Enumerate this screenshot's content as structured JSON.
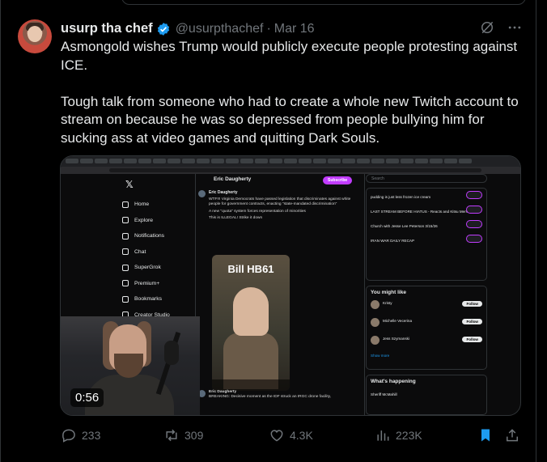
{
  "post": {
    "author_name": "usurp tha chef",
    "handle": "@usurpthachef",
    "separator": "·",
    "date": "Mar 16",
    "paragraphs": [
      "Asmongold wishes Trump would publicly execute people protesting against ICE.",
      "Tough talk from someone who had to create a whole new Twitch account to stream on because he was so depressed from people bullying him for sucking ass at video games and quitting Dark Souls."
    ]
  },
  "media": {
    "duration": "0:56",
    "screen": {
      "nav": [
        "Home",
        "Explore",
        "Notifications",
        "Chat",
        "SuperGrok",
        "Premium+",
        "Bookmarks",
        "Creator Studio"
      ],
      "profile_name": "Eric Daugherty",
      "subscribe_label": "Subscribe",
      "post_text": "WTF!!! Virginia Democrats have passed legislation that discriminates against white people for government contracts, enacting \"state-mandated discrimination\"",
      "post_text_2": "A new \"quota\" system forces representation of minorities",
      "post_text_3": "This is ILLEGAL! Strike it down",
      "video_caption": "Bill HB61",
      "post2_text": "BREAKING: Decisive moment as the IDF struck an IRGC drone facility,",
      "search_placeholder": "Search",
      "trends": [
        "pudding is just less frozen ice cream",
        "LAST STREAM BEFORE HIATUS - Reacts and Kitsu Meme ...",
        "Church with Jesse Lee Peterson 3/15/26",
        "IRAN WAR DAILY RECAP"
      ],
      "you_might_like": "You might like",
      "users": [
        "Kristy",
        "Michelle Vecerina",
        "Jess Szymanski"
      ],
      "follow_label": "Follow",
      "show_more": "Show more",
      "whats_happening": "What's happening",
      "happening_item": "Sheriff McMahill"
    }
  },
  "actions": {
    "replies": "233",
    "reposts": "309",
    "likes": "4.3K",
    "views": "223K"
  },
  "colors": {
    "background": "#000000",
    "text": "#e7e9ea",
    "muted": "#71767b",
    "accent": "#1d9bf0",
    "verified": "#1d9bf0"
  }
}
